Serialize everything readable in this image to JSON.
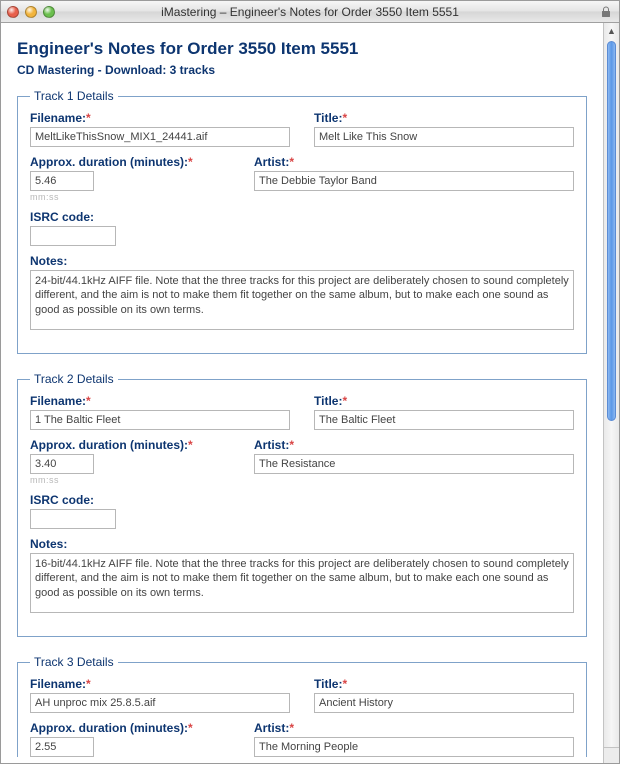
{
  "window_title": "iMastering – Engineer's Notes for Order 3550 Item 5551",
  "page_title": "Engineer's Notes for Order 3550 Item 5551",
  "subtitle": "CD Mastering - Download: 3 tracks",
  "labels": {
    "filename": "Filename:",
    "title": "Title:",
    "duration": "Approx. duration (minutes):",
    "artist": "Artist:",
    "isrc": "ISRC code:",
    "notes": "Notes:",
    "duration_hint": "mm:ss"
  },
  "tracks": [
    {
      "legend": "Track 1 Details",
      "filename": "MeltLikeThisSnow_MIX1_24441.aif",
      "title": "Melt Like This Snow",
      "duration": "5.46",
      "artist": "The Debbie Taylor Band",
      "isrc": "",
      "notes": "24-bit/44.1kHz AIFF file. Note that the three tracks for this project are deliberately chosen to sound completely different, and the aim is not to make them fit together on the same album, but to make each one sound as good as possible on its own terms."
    },
    {
      "legend": "Track 2 Details",
      "filename": "1 The Baltic Fleet",
      "title": "The Baltic Fleet",
      "duration": "3.40",
      "artist": "The Resistance",
      "isrc": "",
      "notes": "16-bit/44.1kHz AIFF file. Note that the three tracks for this project are deliberately chosen to sound completely different, and the aim is not to make them fit together on the same album, but to make each one sound as good as possible on its own terms."
    },
    {
      "legend": "Track 3 Details",
      "filename": "AH unproc mix 25.8.5.aif",
      "title": "Ancient History",
      "duration": "2.55",
      "artist": "The Morning People",
      "isrc": "",
      "notes": ""
    }
  ]
}
